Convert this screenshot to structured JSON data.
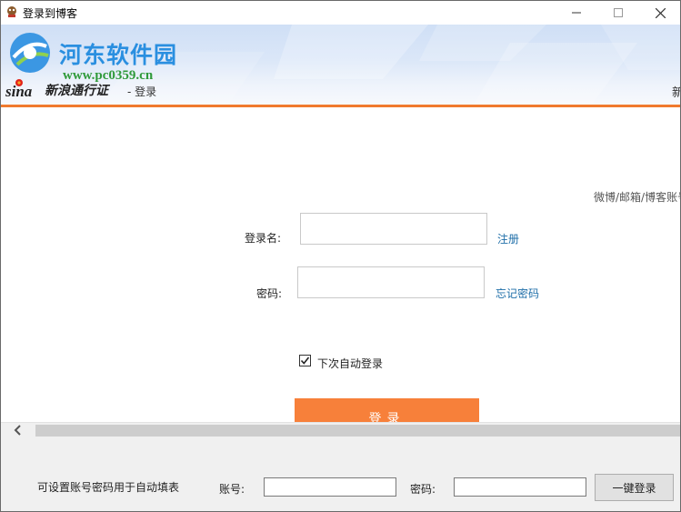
{
  "window": {
    "title": "登录到博客",
    "controls": {
      "minimize": "—",
      "maximize": "☐",
      "close": "✕"
    }
  },
  "watermark": {
    "title": "河东软件园",
    "url": "www.pc0359.cn"
  },
  "banner": {
    "brand_logo_text": "sina",
    "brand_name": "新浪通行证",
    "subtitle": "- 登录",
    "right_text": "新"
  },
  "login": {
    "side_note": "微博/邮箱/博客账号",
    "username_label": "登录名:",
    "username_value": "",
    "register_link": "注册",
    "password_label": "密码:",
    "password_value": "",
    "forgot_link": "忘记密码",
    "auto_login_label": "下次自动登录",
    "auto_login_checked": true,
    "login_button": "登录"
  },
  "bottom": {
    "description": "可设置账号密码用于自动填表",
    "account_label": "账号:",
    "account_value": "",
    "password_label": "密码:",
    "password_value": "",
    "one_click_button": "一键登录"
  },
  "colors": {
    "accent_orange": "#f7803a",
    "banner_line": "#f07a2e",
    "link_blue": "#1e6ea8",
    "watermark_blue": "#2a8fe0",
    "watermark_green": "#2f9a3a"
  }
}
